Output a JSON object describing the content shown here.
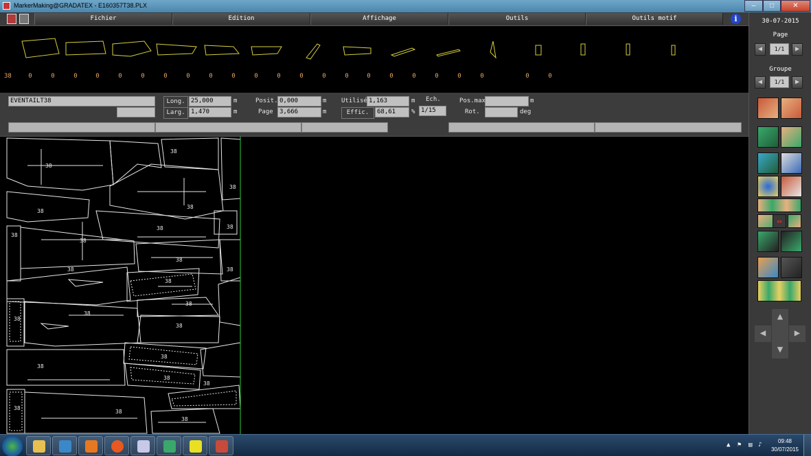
{
  "window": {
    "title": "MarkerMaking@GRADATEX - E160357T38.PLX",
    "minimize_glyph": "–",
    "maximize_glyph": "□",
    "close_glyph": "✕"
  },
  "menu": {
    "items": [
      "Fichier",
      "Edition",
      "Affichage",
      "Outils",
      "Outils motif"
    ],
    "info_glyph": "i"
  },
  "right_panel": {
    "date": "30-07-2015",
    "page_label": "Page",
    "page_value": "1/1",
    "group_label": "Groupe",
    "group_value": "1/1",
    "prev_glyph": "◀",
    "next_glyph": "▶",
    "up_glyph": "▲",
    "down_glyph": "▼"
  },
  "strip": {
    "size_label": "38",
    "quantities": [
      "0",
      "0",
      "0",
      "0",
      "0",
      "0",
      "0",
      "0",
      "0",
      "0",
      "0",
      "0",
      "0",
      "0",
      "0",
      "0",
      "0",
      "0",
      "0",
      "0",
      "0",
      "0",
      "0"
    ]
  },
  "marker": {
    "name": "EVENTAILT38",
    "long_label": "Long.",
    "long_value": "25,000",
    "larg_label": "Larg.",
    "larg_value": "1,470",
    "posit_label": "Posit.",
    "posit_value": "0,000",
    "page_label": "Page",
    "page_value": "3,666",
    "utilise_label": "Utilisé",
    "utilise_value": "1,163",
    "effic_label": "Effic.",
    "effic_value": "68,61",
    "effic_unit": "%",
    "ech_label": "Ech.",
    "ech_value": "1/15",
    "posmax_label": "Pos.max",
    "posmax_value": "",
    "rot_label": "Rot.",
    "rot_value": "",
    "unit_m": "m",
    "unit_deg": "deg"
  },
  "canvas": {
    "piece_labels": [
      "38",
      "38",
      "38",
      "38",
      "38",
      "38",
      "38",
      "38",
      "38",
      "38",
      "38",
      "38",
      "38",
      "38",
      "38",
      "38",
      "38",
      "38",
      "38",
      "38",
      "38",
      "38",
      "38",
      "38"
    ]
  },
  "taskbar": {
    "time": "09:48",
    "date": "30/07/2015"
  },
  "colors": {
    "piece_outline": "#d8d040",
    "quantity_text": "#e8a96a",
    "marker_line": "#2ecc40",
    "piece_white": "#e8e8e8"
  }
}
